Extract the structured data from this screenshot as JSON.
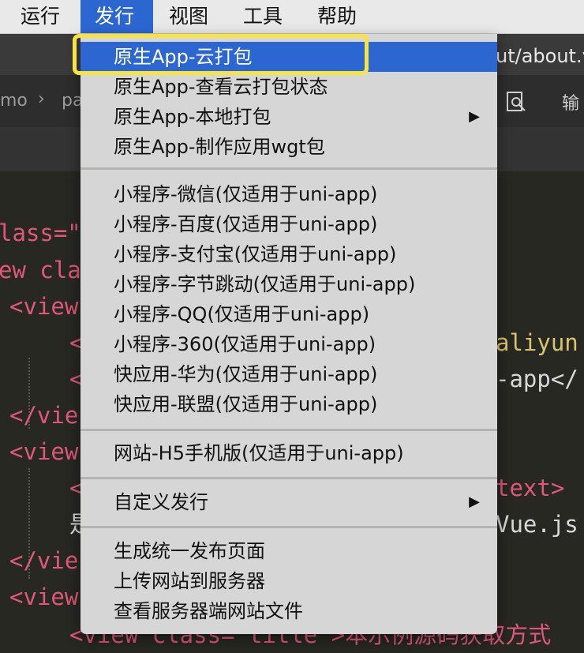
{
  "menubar": {
    "items": [
      {
        "label": "运行"
      },
      {
        "label": "发行",
        "active": true
      },
      {
        "label": "视图"
      },
      {
        "label": "工具"
      },
      {
        "label": "帮助"
      }
    ]
  },
  "editor": {
    "tab_title": "ut/about.v",
    "breadcrumb": [
      "mo",
      "pa"
    ],
    "toolbar_text": "输",
    "code_lines": [
      {
        "a": "lass=\"",
        "b": ""
      },
      {
        "a": "ew cla",
        "b": ""
      },
      {
        "a": "<view",
        "b": ""
      },
      {
        "a": "<",
        "b": "aliyun"
      },
      {
        "a": "<",
        "b": "-app</"
      },
      {
        "a": "</vie",
        "b": ""
      },
      {
        "a": "<view",
        "b": ""
      },
      {
        "a": "<",
        "b": "text>"
      },
      {
        "a": "是",
        "b": "Vue.js"
      },
      {
        "a": "</vie",
        "b": ""
      },
      {
        "a": "<view",
        "b": ""
      },
      {
        "a": "<view class=\"title\">本示例源码获取方式",
        "b": ""
      }
    ]
  },
  "dropdown": {
    "groups": [
      [
        {
          "label": "原生App-云打包",
          "selected": true
        },
        {
          "label": "原生App-查看云打包状态"
        },
        {
          "label": "原生App-本地打包",
          "submenu": true
        },
        {
          "label": "原生App-制作应用wgt包"
        }
      ],
      [
        {
          "label": "小程序-微信(仅适用于uni-app)"
        },
        {
          "label": "小程序-百度(仅适用于uni-app)"
        },
        {
          "label": "小程序-支付宝(仅适用于uni-app)"
        },
        {
          "label": "小程序-字节跳动(仅适用于uni-app)"
        },
        {
          "label": "小程序-QQ(仅适用于uni-app)"
        },
        {
          "label": "小程序-360(仅适用于uni-app)"
        },
        {
          "label": "快应用-华为(仅适用于uni-app)"
        },
        {
          "label": "快应用-联盟(仅适用于uni-app)"
        }
      ],
      [
        {
          "label": "网站-H5手机版(仅适用于uni-app)"
        }
      ],
      [
        {
          "label": "自定义发行",
          "submenu": true
        }
      ],
      [
        {
          "label": "生成统一发布页面"
        },
        {
          "label": "上传网站到服务器"
        },
        {
          "label": "查看服务器端网站文件"
        }
      ]
    ],
    "submenu_glyph": "▶"
  },
  "colors": {
    "selection": "#2c67d1",
    "menu_bg": "#d6d6d6",
    "callout": "#f7e341",
    "keyword": "#e0577a",
    "string": "#d8c46b"
  }
}
